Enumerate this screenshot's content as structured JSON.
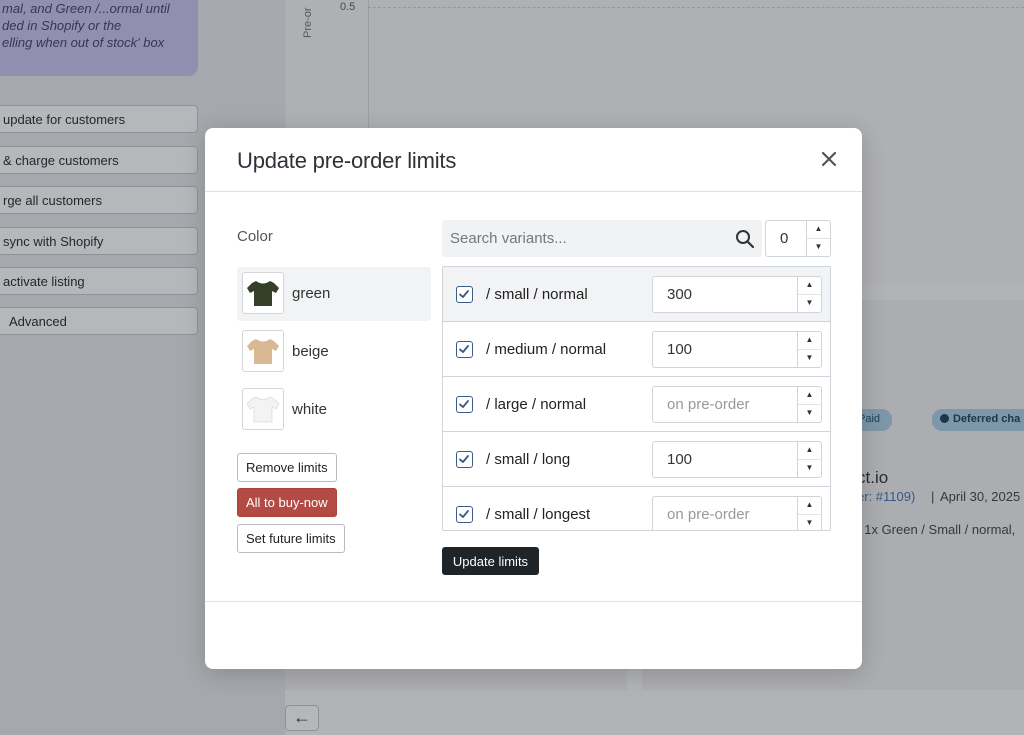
{
  "background": {
    "notice_lines": [
      "mal, and Green /...ormal until",
      "ded in Shopify or the",
      "elling when out of stock' box"
    ],
    "sidebar_buttons": [
      "update for customers",
      "& charge customers",
      "rge all customers",
      "sync with Shopify",
      "activate listing",
      "Advanced"
    ],
    "chart": {
      "ylabel": "Pre-or",
      "tick": "0.5"
    },
    "badges": {
      "paid": "Paid",
      "deferred": "Deferred cha"
    },
    "order": {
      "name": "ct.io",
      "order_ref": "er: #1109)",
      "sep": "|",
      "date": "April 30, 2025",
      "items": ": 1x Green / Small / normal,"
    },
    "back_arrow": "←"
  },
  "modal": {
    "title": "Update pre-order limits",
    "close_label": "×",
    "color_label": "Color",
    "colors": [
      {
        "name": "green",
        "shirt_color": "#34402a"
      },
      {
        "name": "beige",
        "shirt_color": "#d9b994"
      },
      {
        "name": "white",
        "shirt_color": "#f3f3f3"
      }
    ],
    "buttons": {
      "remove": "Remove limits",
      "buy_now": "All to buy-now",
      "future": "Set future limits",
      "update": "Update limits"
    },
    "search": {
      "placeholder": "Search variants...",
      "icon": "search-icon"
    },
    "bulk_value": "0",
    "variants": [
      {
        "name": "/ small / normal",
        "value": "300",
        "placeholder": "on pre-order",
        "checked": true
      },
      {
        "name": "/ medium / normal",
        "value": "100",
        "placeholder": "on pre-order",
        "checked": true
      },
      {
        "name": "/ large / normal",
        "value": "",
        "placeholder": "on pre-order",
        "checked": true
      },
      {
        "name": "/ small / long",
        "value": "100",
        "placeholder": "on pre-order",
        "checked": true
      },
      {
        "name": "/ small / longest",
        "value": "",
        "placeholder": "on pre-order",
        "checked": true
      }
    ],
    "colors_ui": {
      "danger": "#b34a44",
      "primary": "#1f2428",
      "checkbox": "#3b5b86"
    }
  }
}
